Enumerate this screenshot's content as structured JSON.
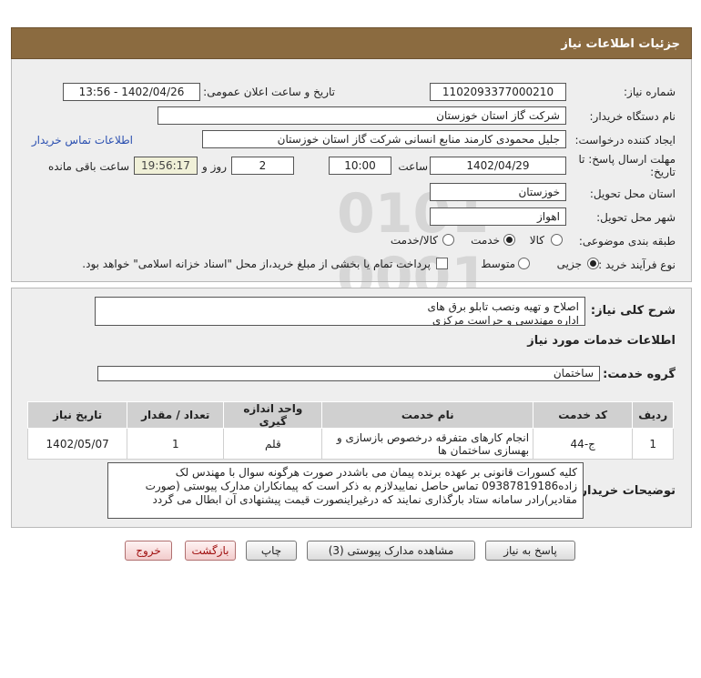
{
  "header": {
    "title": "جزئیات اطلاعات نیاز"
  },
  "fields": {
    "need_number_label": "شماره نیاز:",
    "need_number": "1102093377000210",
    "announce_label": "تاریخ و ساعت اعلان عمومی:",
    "announce_value": "1402/04/26 - 13:56",
    "buyer_org_label": "نام دستگاه خریدار:",
    "buyer_org": "شرکت گاز استان خوزستان",
    "creator_label": "ایجاد کننده درخواست:",
    "creator": "جلیل محمودی کارمند منابع انسانی شرکت گاز استان خوزستان",
    "contact_link": "اطلاعات تماس خریدار",
    "deadline_label_1": "مهلت ارسال پاسخ: تا",
    "deadline_label_2": "تاریخ:",
    "deadline_date": "1402/04/29",
    "time_label": "ساعت",
    "deadline_time": "10:00",
    "days_value": "2",
    "days_label": "روز و",
    "remaining_time": "19:56:17",
    "remaining_label": "ساعت باقی مانده",
    "province_label": "استان محل تحویل:",
    "province": "خوزستان",
    "city_label": "شهر محل تحویل:",
    "city": "اهواز",
    "category_label": "طبقه بندی موضوعی:",
    "category_options": [
      "کالا",
      "خدمت",
      "کالا/خدمت"
    ],
    "process_label": "نوع فرآیند خرید :",
    "process_options": [
      "جزیی",
      "متوسط"
    ],
    "payment_note": "پرداخت تمام یا بخشی از مبلغ خرید،از محل \"اسناد خزانه اسلامی\" خواهد بود."
  },
  "summary": {
    "label": "شرح کلی نیاز:",
    "text": "اصلاح و تهیه ونصب تابلو برق  های\nاداره مهندسی و حراست مرکزی"
  },
  "services": {
    "section_title": "اطلاعات خدمات مورد نیاز",
    "group_label": "گروه خدمت:",
    "group_value": "ساختمان"
  },
  "table": {
    "headers": [
      "ردیف",
      "کد خدمت",
      "نام خدمت",
      "واحد اندازه گیری",
      "تعداد / مقدار",
      "تاریخ نیاز"
    ],
    "rows": [
      {
        "index": "1",
        "code": "ج-44",
        "name": "انجام کارهای متفرقه درخصوص بازسازی و بهسازی ساختمان ها",
        "unit": "قلم",
        "qty": "1",
        "date": "1402/05/07"
      }
    ]
  },
  "buyer_notes": {
    "label": "توضیحات خریدار:",
    "text": "کلیه کسورات قانونی بر عهده برنده پیمان می باشددر صورت هرگونه سوال با مهندس لک زاده09387819186 تماس حاصل نماییدلازم به ذکر است که پیمانکاران مدارک پیوستی (صورت مقادیر)رادر سامانه ستاد بارگذاری نمایند که درغیراینصورت قیمت پیشنهادی آن ابطال می گردد"
  },
  "buttons": {
    "reply": "پاسخ به نیاز",
    "attachments": "مشاهده مدارک پیوستی (3)",
    "print": "چاپ",
    "back": "بازگشت",
    "exit": "خروج"
  }
}
